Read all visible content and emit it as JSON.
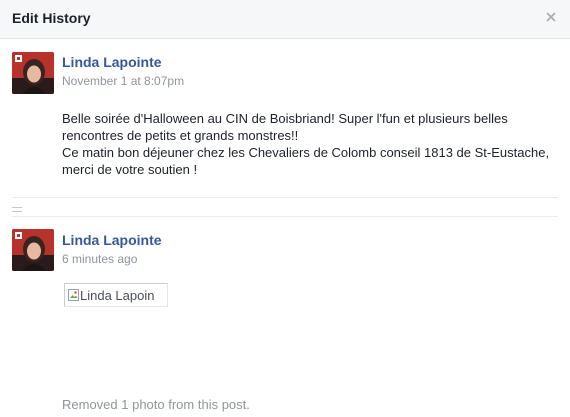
{
  "dialog": {
    "title": "Edit History",
    "close_icon": "close-icon"
  },
  "entries": [
    {
      "author": "Linda Lapointe",
      "timestamp": "November 1 at 8:07pm",
      "text_lines": [
        "Belle soirée d'Halloween au CIN de Boisbriand! Super l'fun et plusieurs belles rencontres de petits et grands monstres!!",
        "Ce matin bon déjeuner chez les Chevaliers de Colomb conseil 1813 de St-Eustache, merci de votre soutien !"
      ]
    },
    {
      "author": "Linda Lapointe",
      "timestamp": "6 minutes ago",
      "image_alt": "Linda Lapoin",
      "note": "Removed 1 photo from this post."
    }
  ],
  "colors": {
    "author_link": "#365899",
    "meta_text": "#90949c",
    "header_bg": "#f6f7f9",
    "avatar_accent": "#b8322c"
  }
}
